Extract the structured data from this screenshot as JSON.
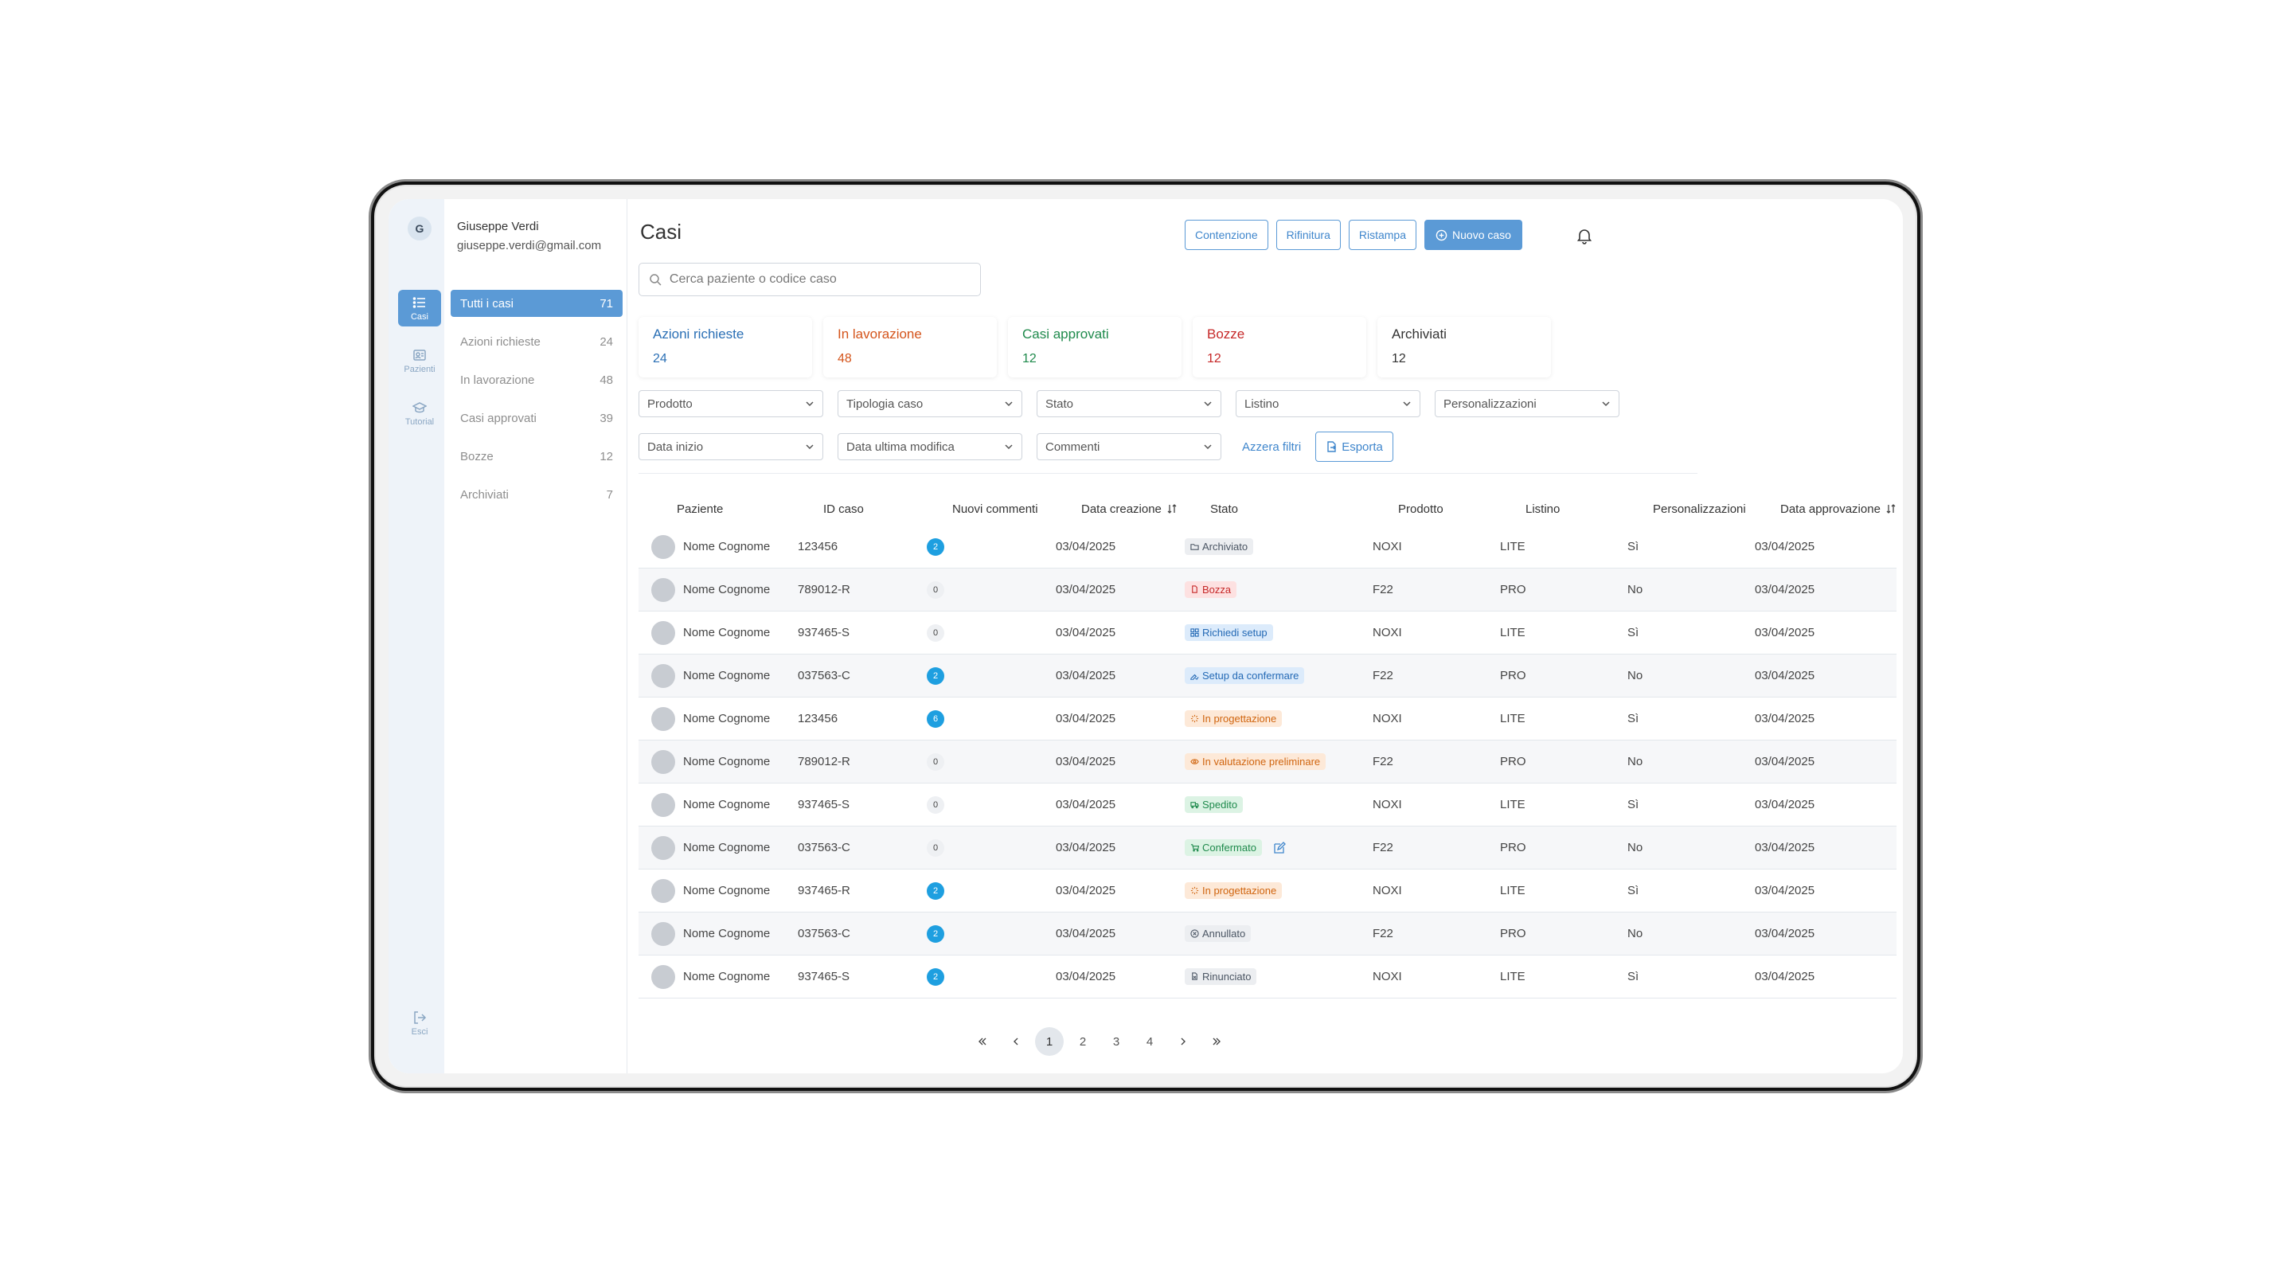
{
  "colors": {
    "accent": "#5b9ad6",
    "badge": "#1e9fe0",
    "rail_bg": "#eef3f9"
  },
  "user": {
    "initial": "G",
    "name": "Giuseppe Verdi",
    "email": "giuseppe.verdi@gmail.com"
  },
  "rail": {
    "casi": "Casi",
    "pazienti": "Pazienti",
    "tutorial": "Tutorial",
    "esci": "Esci"
  },
  "nav": [
    {
      "label": "Tutti i casi",
      "count": "71"
    },
    {
      "label": "Azioni richieste",
      "count": "24"
    },
    {
      "label": "In lavorazione",
      "count": "48"
    },
    {
      "label": "Casi approvati",
      "count": "39"
    },
    {
      "label": "Bozze",
      "count": "12"
    },
    {
      "label": "Archiviati",
      "count": "7"
    }
  ],
  "header": {
    "title": "Casi",
    "buttons": {
      "contenzione": "Contenzione",
      "rifinitura": "Rifinitura",
      "ristampa": "Ristampa",
      "nuovo": "Nuovo caso"
    }
  },
  "search": {
    "placeholder": "Cerca paziente o codice caso"
  },
  "stats": [
    {
      "label": "Azioni richieste",
      "value": "24",
      "color": "#2a6fb5"
    },
    {
      "label": "In lavorazione",
      "value": "48",
      "color": "#d4541b"
    },
    {
      "label": "Casi approvati",
      "value": "12",
      "color": "#1f8a4c"
    },
    {
      "label": "Bozze",
      "value": "12",
      "color": "#c62828"
    },
    {
      "label": "Archiviati",
      "value": "12",
      "color": "#333333"
    }
  ],
  "filters": {
    "row1": [
      "Prodotto",
      "Tipologia caso",
      "Stato",
      "Listino",
      "Personalizzazioni"
    ],
    "row2": [
      "Data inizio",
      "Data ultima modifica",
      "Commenti"
    ],
    "reset": "Azzera filtri",
    "export": "Esporta"
  },
  "table": {
    "headers": [
      "Paziente",
      "ID caso",
      "Nuovi commenti",
      "Data creazione",
      "Stato",
      "Prodotto",
      "Listino",
      "Personalizzazioni",
      "Data approvazione"
    ],
    "rows": [
      {
        "name": "Nome Cognome",
        "id": "123456",
        "comments": "2",
        "created": "03/04/2025",
        "status": "Archiviato",
        "product": "NOXI",
        "listino": "LITE",
        "pers": "Sì",
        "approved": "03/04/2025"
      },
      {
        "name": "Nome Cognome",
        "id": "789012-R",
        "comments": "0",
        "created": "03/04/2025",
        "status": "Bozza",
        "product": "F22",
        "listino": "PRO",
        "pers": "No",
        "approved": "03/04/2025"
      },
      {
        "name": "Nome Cognome",
        "id": "937465-S",
        "comments": "0",
        "created": "03/04/2025",
        "status": "Richiedi setup",
        "product": "NOXI",
        "listino": "LITE",
        "pers": "Sì",
        "approved": "03/04/2025"
      },
      {
        "name": "Nome Cognome",
        "id": "037563-C",
        "comments": "2",
        "created": "03/04/2025",
        "status": "Setup da confermare",
        "product": "F22",
        "listino": "PRO",
        "pers": "No",
        "approved": "03/04/2025"
      },
      {
        "name": "Nome Cognome",
        "id": "123456",
        "comments": "6",
        "created": "03/04/2025",
        "status": "In progettazione",
        "product": "NOXI",
        "listino": "LITE",
        "pers": "Sì",
        "approved": "03/04/2025"
      },
      {
        "name": "Nome Cognome",
        "id": "789012-R",
        "comments": "0",
        "created": "03/04/2025",
        "status": "In valutazione preliminare",
        "product": "F22",
        "listino": "PRO",
        "pers": "No",
        "approved": "03/04/2025"
      },
      {
        "name": "Nome Cognome",
        "id": "937465-S",
        "comments": "0",
        "created": "03/04/2025",
        "status": "Spedito",
        "product": "NOXI",
        "listino": "LITE",
        "pers": "Sì",
        "approved": "03/04/2025"
      },
      {
        "name": "Nome Cognome",
        "id": "037563-C",
        "comments": "0",
        "created": "03/04/2025",
        "status": "Confermato",
        "product": "F22",
        "listino": "PRO",
        "pers": "No",
        "approved": "03/04/2025"
      },
      {
        "name": "Nome Cognome",
        "id": "937465-R",
        "comments": "2",
        "created": "03/04/2025",
        "status": "In progettazione",
        "product": "NOXI",
        "listino": "LITE",
        "pers": "Sì",
        "approved": "03/04/2025"
      },
      {
        "name": "Nome Cognome",
        "id": "037563-C",
        "comments": "2",
        "created": "03/04/2025",
        "status": "Annullato",
        "product": "F22",
        "listino": "PRO",
        "pers": "No",
        "approved": "03/04/2025"
      },
      {
        "name": "Nome Cognome",
        "id": "937465-S",
        "comments": "2",
        "created": "03/04/2025",
        "status": "Rinunciato",
        "product": "NOXI",
        "listino": "LITE",
        "pers": "Sì",
        "approved": "03/04/2025"
      }
    ]
  },
  "pagination": {
    "pages": [
      "1",
      "2",
      "3",
      "4"
    ],
    "current": "1"
  }
}
